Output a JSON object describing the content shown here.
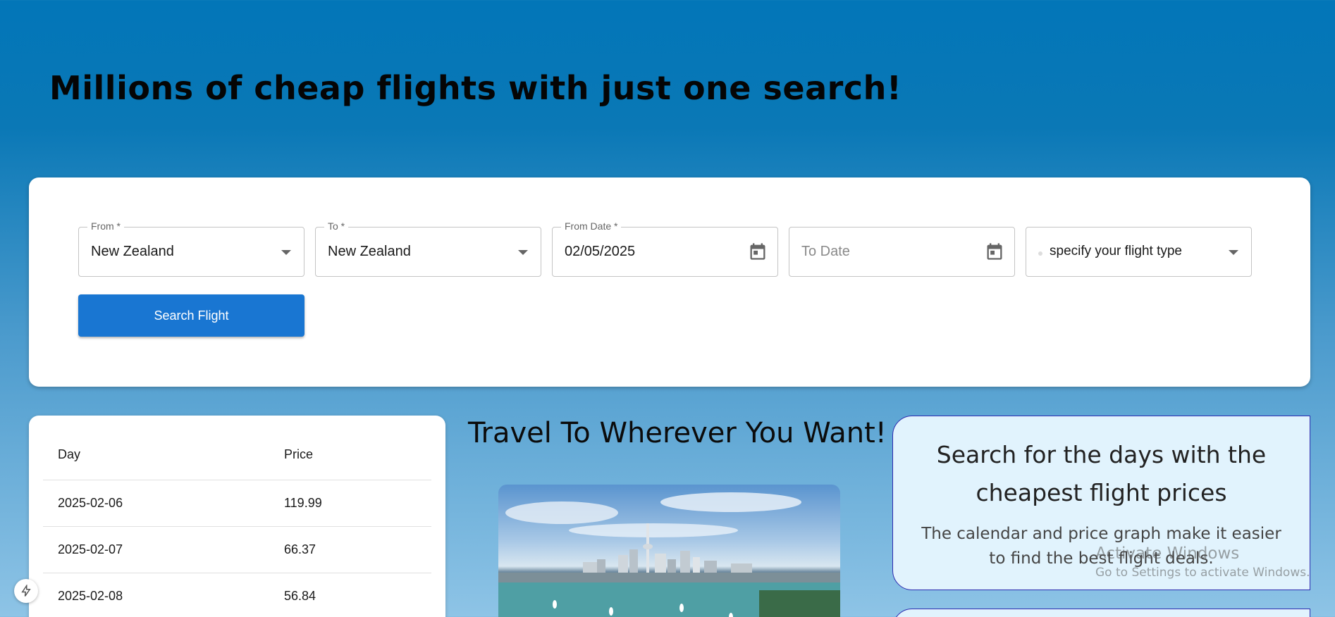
{
  "hero": {
    "title": "Millions of cheap flights with just one search!"
  },
  "search": {
    "from": {
      "label": "From *",
      "value": "New Zealand"
    },
    "to": {
      "label": "To *",
      "value": "New Zealand"
    },
    "from_date": {
      "label": "From Date *",
      "value": "02/05/2025"
    },
    "to_date": {
      "placeholder": "To Date"
    },
    "flight_type": {
      "value": "specify your flight type"
    },
    "button": "Search Flight"
  },
  "price_table": {
    "headers": [
      "Day",
      "Price"
    ],
    "rows": [
      [
        "2025-02-06",
        "119.99"
      ],
      [
        "2025-02-07",
        "66.37"
      ],
      [
        "2025-02-08",
        "56.84"
      ]
    ]
  },
  "promo": {
    "title": "Travel To Wherever You Want!"
  },
  "info": {
    "title": "Search for the days with the cheapest flight prices",
    "body": "The calendar and price graph make it easier to find the best flight deals."
  },
  "watermark": {
    "line1": "Activate Windows",
    "line2": "Go to Settings to activate Windows."
  },
  "colors": {
    "primary_button": "#1976d2",
    "info_border": "#2d2bb0",
    "info_bg": "#e1f3fd"
  }
}
